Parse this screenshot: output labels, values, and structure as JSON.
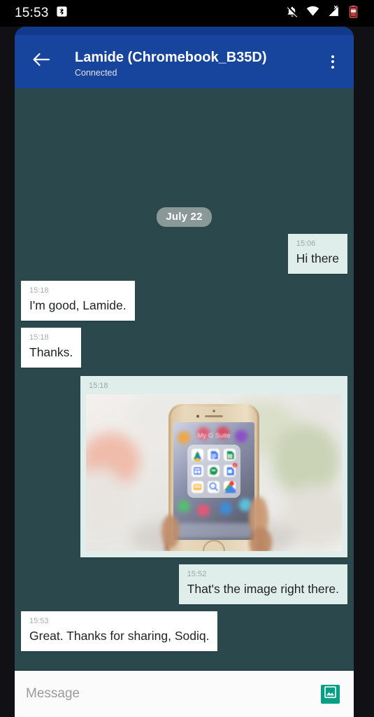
{
  "status_bar": {
    "clock": "15:53",
    "left_icons": [
      "bluetooth-icon"
    ],
    "right_icons": [
      "notifications-off-icon",
      "wifi-icon",
      "cellular-no-service-icon",
      "battery-icon"
    ]
  },
  "toolbar": {
    "back_icon": "back-arrow-icon",
    "title": "Lamide (Chromebook_B35D)",
    "subtitle": "Connected",
    "overflow_icon": "overflow-menu-icon",
    "background_color": "#17449c"
  },
  "conversation": {
    "background_color": "#2b494d",
    "date_divider": "July 22",
    "messages": [
      {
        "id": 0,
        "direction": "out",
        "type": "text",
        "time": "15:06",
        "text": "Hi there"
      },
      {
        "id": 1,
        "direction": "in",
        "type": "text",
        "time": "15:18",
        "text": "I'm good, Lamide."
      },
      {
        "id": 2,
        "direction": "in",
        "type": "text",
        "time": "15:18",
        "text": "Thanks."
      },
      {
        "id": 3,
        "direction": "out",
        "type": "image",
        "time": "15:18",
        "text": "",
        "image_description": "Hand holding a gold iPhone showing a My G Suite app folder",
        "image_folder_label": "My G Suite"
      },
      {
        "id": 4,
        "direction": "out",
        "type": "text",
        "time": "15:52",
        "text": "That's the image right there."
      },
      {
        "id": 5,
        "direction": "in",
        "type": "text",
        "time": "15:53",
        "text": "Great. Thanks for sharing, Sodiq."
      }
    ],
    "outgoing_bubble_color": "#dfeeea",
    "incoming_bubble_color": "#ffffff"
  },
  "composer": {
    "placeholder": "Message",
    "value": "",
    "attach_icon": "image-attachment-icon",
    "attach_color": "#079e86"
  }
}
